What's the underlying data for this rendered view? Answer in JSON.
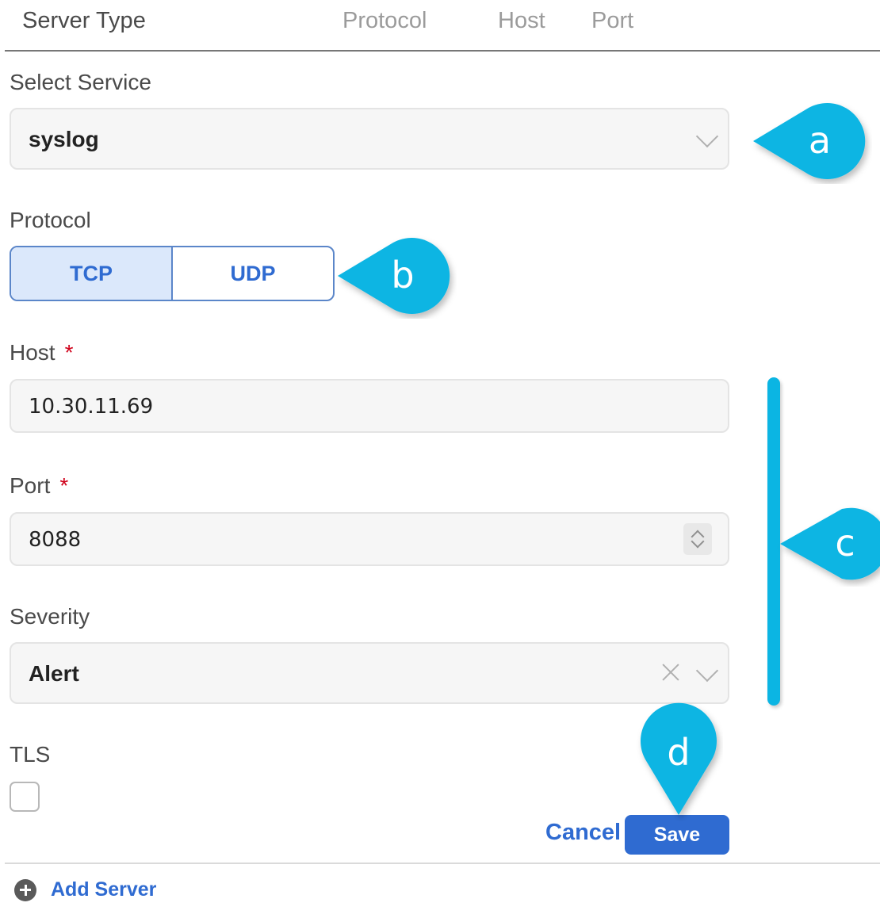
{
  "table_header": {
    "server_type": "Server Type",
    "protocol": "Protocol",
    "host": "Host",
    "port": "Port"
  },
  "form": {
    "select_service": {
      "label": "Select Service",
      "value": "syslog"
    },
    "protocol": {
      "label": "Protocol",
      "options": [
        "TCP",
        "UDP"
      ],
      "selected": "TCP"
    },
    "host": {
      "label": "Host",
      "required_mark": "*",
      "value": "10.30.11.69"
    },
    "port": {
      "label": "Port",
      "required_mark": "*",
      "value": "8088"
    },
    "severity": {
      "label": "Severity",
      "value": "Alert"
    },
    "tls": {
      "label": "TLS",
      "checked": false
    }
  },
  "actions": {
    "cancel_label": "Cancel",
    "save_label": "Save"
  },
  "footer": {
    "add_server_label": "Add Server"
  },
  "callouts": {
    "a": "a",
    "b": "b",
    "c": "c",
    "d": "d"
  },
  "colors": {
    "accent": "#2f6bd1",
    "callout": "#0bb5e3",
    "required": "#d0021b"
  }
}
